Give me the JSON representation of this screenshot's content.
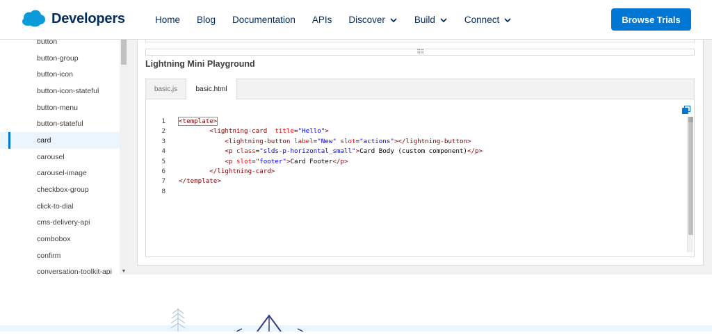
{
  "header": {
    "logo_text": "Developers",
    "nav": [
      {
        "label": "Home",
        "dropdown": false
      },
      {
        "label": "Blog",
        "dropdown": false
      },
      {
        "label": "Documentation",
        "dropdown": false
      },
      {
        "label": "APIs",
        "dropdown": false
      },
      {
        "label": "Discover",
        "dropdown": true
      },
      {
        "label": "Build",
        "dropdown": true
      },
      {
        "label": "Connect",
        "dropdown": true
      }
    ],
    "cta_label": "Browse Trials",
    "brand_color": "#0176d3",
    "nav_color": "#032d60"
  },
  "sidebar": {
    "items": [
      {
        "label": "button",
        "active": false
      },
      {
        "label": "button-group",
        "active": false
      },
      {
        "label": "button-icon",
        "active": false
      },
      {
        "label": "button-icon-stateful",
        "active": false
      },
      {
        "label": "button-menu",
        "active": false
      },
      {
        "label": "button-stateful",
        "active": false
      },
      {
        "label": "card",
        "active": true
      },
      {
        "label": "carousel",
        "active": false
      },
      {
        "label": "carousel-image",
        "active": false
      },
      {
        "label": "checkbox-group",
        "active": false
      },
      {
        "label": "click-to-dial",
        "active": false
      },
      {
        "label": "cms-delivery-api",
        "active": false
      },
      {
        "label": "combobox",
        "active": false
      },
      {
        "label": "confirm",
        "active": false
      },
      {
        "label": "conversation-toolkit-api",
        "active": false
      }
    ]
  },
  "playground": {
    "title": "Lightning Mini Playground",
    "tabs": [
      {
        "label": "basic.js",
        "active": false
      },
      {
        "label": "basic.html",
        "active": true
      }
    ],
    "code_lines": [
      {
        "n": "1",
        "indent": "",
        "tokens": [
          [
            "tag",
            "<template>"
          ]
        ]
      },
      {
        "n": "2",
        "indent": "        ",
        "tokens": [
          [
            "tag",
            "<lightning-card"
          ],
          [
            "txt",
            "  "
          ],
          [
            "attr",
            "title"
          ],
          [
            "txt",
            "="
          ],
          [
            "str",
            "\"Hello\""
          ],
          [
            "tag",
            ">"
          ]
        ]
      },
      {
        "n": "3",
        "indent": "            ",
        "tokens": [
          [
            "tag",
            "<lightning-button"
          ],
          [
            "txt",
            " "
          ],
          [
            "attr",
            "label"
          ],
          [
            "txt",
            "="
          ],
          [
            "str",
            "\"New\""
          ],
          [
            "txt",
            " "
          ],
          [
            "attr",
            "slot"
          ],
          [
            "txt",
            "="
          ],
          [
            "str",
            "\"actions\""
          ],
          [
            "tag",
            "></lightning-button>"
          ]
        ]
      },
      {
        "n": "4",
        "indent": "            ",
        "tokens": [
          [
            "tag",
            "<p"
          ],
          [
            "txt",
            " "
          ],
          [
            "attr",
            "class"
          ],
          [
            "txt",
            "="
          ],
          [
            "str",
            "\"slds-p-horizontal_small\""
          ],
          [
            "tag",
            ">"
          ],
          [
            "txt",
            "Card Body (custom component)"
          ],
          [
            "tag",
            "</p>"
          ]
        ]
      },
      {
        "n": "5",
        "indent": "            ",
        "tokens": [
          [
            "tag",
            "<p"
          ],
          [
            "txt",
            " "
          ],
          [
            "attr",
            "slot"
          ],
          [
            "txt",
            "="
          ],
          [
            "str",
            "\"footer\""
          ],
          [
            "tag",
            ">"
          ],
          [
            "txt",
            "Card Footer"
          ],
          [
            "tag",
            "</p>"
          ]
        ]
      },
      {
        "n": "6",
        "indent": "        ",
        "tokens": [
          [
            "tag",
            "</lightning-card>"
          ]
        ]
      },
      {
        "n": "7",
        "indent": "",
        "tokens": [
          [
            "tag",
            "</template>"
          ]
        ]
      },
      {
        "n": "8",
        "indent": "",
        "tokens": []
      }
    ]
  },
  "icons": {
    "logo": "salesforce-cloud-icon",
    "dropdown": "chevron-down-icon",
    "copy": "copy-icon",
    "grip": "drag-grip-icon"
  }
}
